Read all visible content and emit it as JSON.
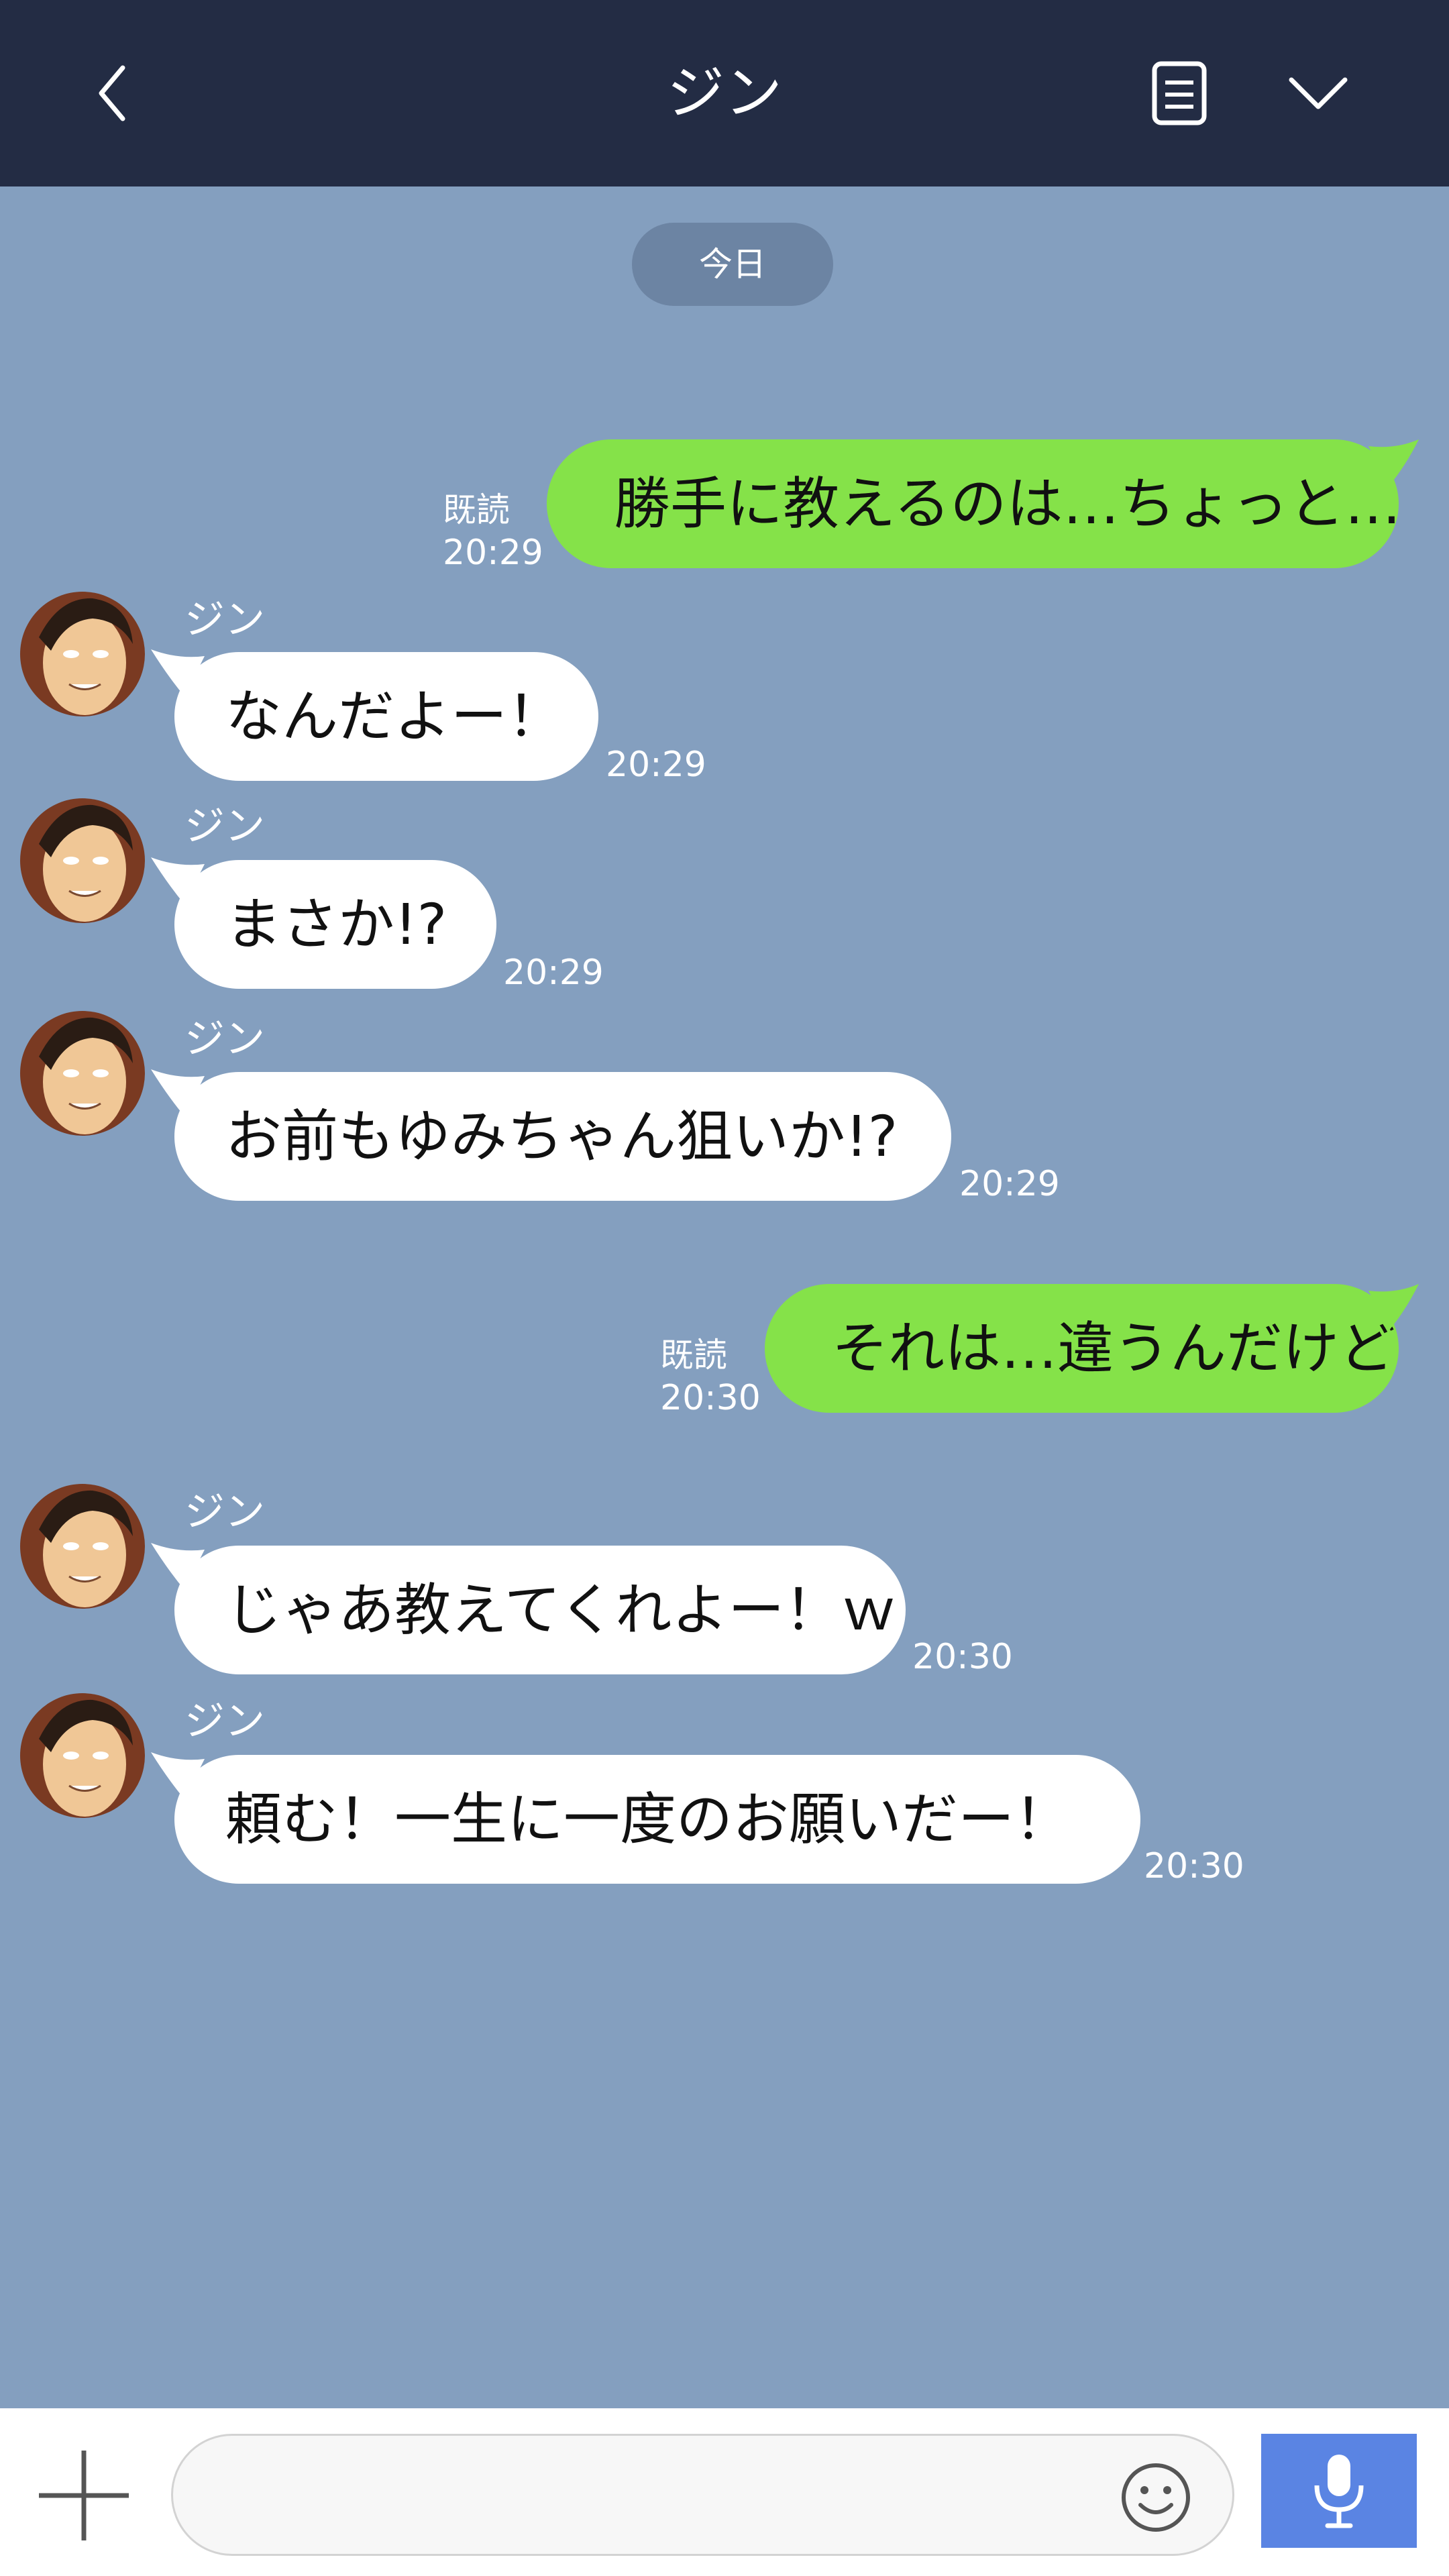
{
  "header": {
    "title": "ジン"
  },
  "date_label": "今日",
  "messages": [
    {
      "side": "out",
      "text": "勝手に教えるのは…ちょっと…",
      "read": "既読",
      "time": "20:29"
    },
    {
      "side": "in",
      "sender": "ジン",
      "text": "なんだよー！",
      "time": "20:29"
    },
    {
      "side": "in",
      "sender": "ジン",
      "text": "まさか!?",
      "time": "20:29"
    },
    {
      "side": "in",
      "sender": "ジン",
      "text": "お前もゆみちゃん狙いか!?",
      "time": "20:29"
    },
    {
      "side": "out",
      "text": "それは…違うんだけど",
      "read": "既読",
      "time": "20:30"
    },
    {
      "side": "in",
      "sender": "ジン",
      "text": "じゃあ教えてくれよー！ｗ",
      "time": "20:30"
    },
    {
      "side": "in",
      "sender": "ジン",
      "text": "頼む！一生に一度のお願いだー！",
      "time": "20:30"
    }
  ],
  "input": {
    "placeholder": ""
  },
  "icons": {
    "back": "chevron-left-icon",
    "notes": "notes-icon",
    "menu": "chevron-down-icon",
    "add": "plus-icon",
    "emoji": "smiley-icon",
    "mic": "microphone-icon"
  },
  "colors": {
    "header_bg": "#232c44",
    "chat_bg": "#849fbf",
    "outgoing_bubble": "#85e249",
    "incoming_bubble": "#ffffff",
    "mic_button": "#5a84e3"
  }
}
